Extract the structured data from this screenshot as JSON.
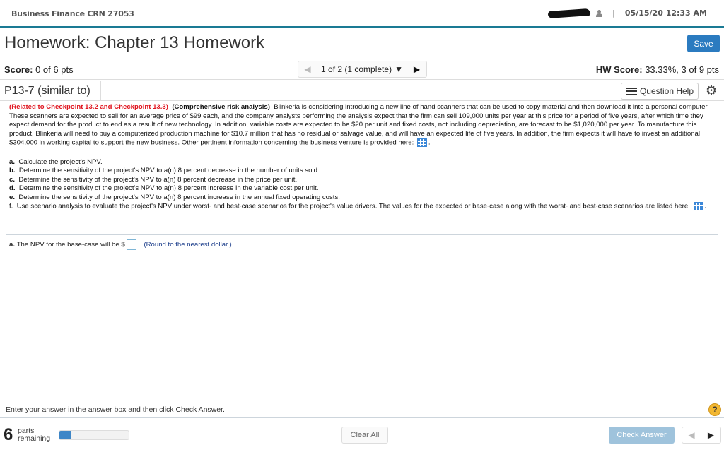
{
  "header": {
    "course": "Business Finance CRN 27053",
    "datetime": "05/15/20 12:33 AM",
    "separator": "|"
  },
  "title": {
    "text": "Homework: Chapter 13 Homework",
    "save_label": "Save"
  },
  "score": {
    "label": "Score:",
    "value": "0 of 6 pts",
    "hw_label": "HW Score:",
    "hw_value": "33.33%, 3 of 9 pts"
  },
  "pager": {
    "prev_icon": "◀",
    "current": "1 of 2 (1 complete)",
    "dropdown_icon": "▼",
    "next_icon": "▶"
  },
  "question": {
    "id": "P13-7 (similar to)",
    "help_label": "Question Help",
    "gear_icon": "⚙",
    "related": "(Related to Checkpoint 13.2 and Checkpoint 13.3)",
    "topic": "(Comprehensive risk analysis)",
    "body": "Blinkeria is considering introducing a new line of hand scanners that can be used to copy material and then download it into a personal computer.  These scanners are expected to sell for an average price of $99 each, and the company analysts performing the analysis expect that the firm can sell 109,000 units per year at this price for a period of five years, after which time they expect demand for the product to end as a result of new technology.  In addition, variable costs are expected to be $20 per unit and fixed costs, not including depreciation, are forecast to be $1,020,000 per year.  To manufacture this product, Blinkeria will need to buy a computerized production machine for $10.7 million that has no residual or salvage value, and will have an expected life of five years.  In addition, the firm expects it will have to invest an additional $304,000 in working capital to support the new business.  Other pertinent information concerning the business venture is provided here:",
    "parts": [
      {
        "letter": "a.",
        "text": "Calculate the project's NPV."
      },
      {
        "letter": "b.",
        "text": "Determine the sensitivity of the project's NPV to a(n) 8 percent decrease in the number of units sold."
      },
      {
        "letter": "c.",
        "text": "Determine the sensitivity of the project's NPV to a(n) 8 percent decrease in the price per unit."
      },
      {
        "letter": "d.",
        "text": "Determine the sensitivity of the project's NPV to a(n) 8 percent increase in the variable cost per unit."
      },
      {
        "letter": "e.",
        "text": "Determine the sensitivity of the project's NPV to a(n) 8 percent increase in the annual fixed operating costs."
      },
      {
        "letter": "f.",
        "text": "Use scenario analysis to evaluate the project's NPV under worst- and best-case scenarios for the project's value drivers.  The values for the expected or base-case along with the worst- and best-case scenarios are listed here:"
      }
    ],
    "answer_letter": "a.",
    "answer_prompt": "The NPV for the base-case will be $",
    "answer_value": "",
    "answer_suffix": ".",
    "answer_hint": "(Round to the nearest dollar.)"
  },
  "footer": {
    "instructions": "Enter your answer in the answer box and then click Check Answer.",
    "help_icon": "?",
    "parts_remaining": "6",
    "parts_label_1": "parts",
    "parts_label_2": "remaining",
    "progress_fraction": 0.17,
    "clear_label": "Clear All",
    "check_label": "Check Answer",
    "prev_icon": "◀",
    "next_icon": "▶"
  }
}
